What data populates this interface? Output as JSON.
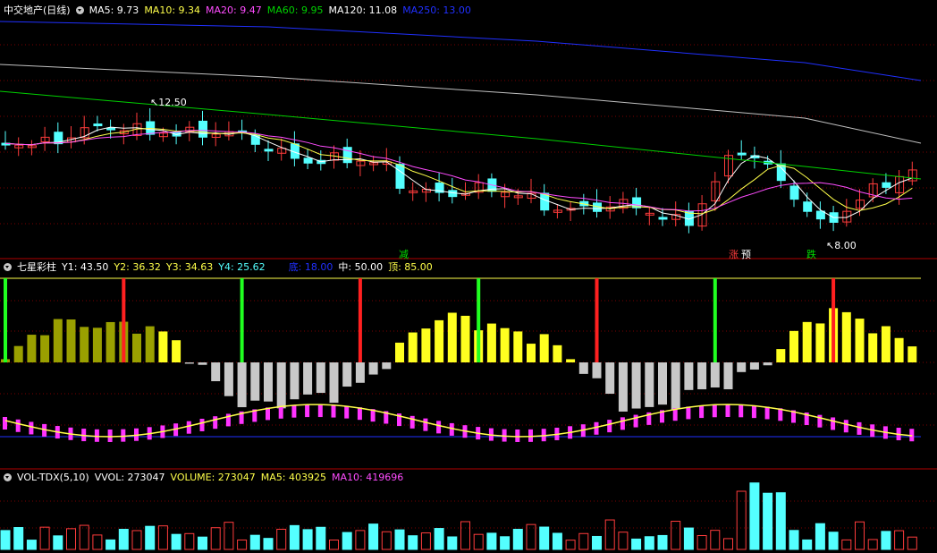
{
  "colors": {
    "up": "#ff3c3c",
    "down": "#54ffff",
    "ma5": "#ffffff",
    "ma10": "#ffff4a",
    "ma20": "#ff4cff",
    "ma60": "#00d000",
    "ma120": "#c0c0c0",
    "ma250": "#2030ff",
    "grid": "#7a0000"
  },
  "main": {
    "menu_icon": "chevron-down-icon",
    "title": "中交地产(日线)",
    "indicators": [
      {
        "text": "MA5: 9.73",
        "color": "#ffffff"
      },
      {
        "text": "MA10: 9.34",
        "color": "#ffff4a"
      },
      {
        "text": "MA20: 9.47",
        "color": "#ff4cff"
      },
      {
        "text": "MA60: 9.95",
        "color": "#00d000"
      },
      {
        "text": "MA120: 11.08",
        "color": "#ffffff"
      },
      {
        "text": "MA250: 13.00",
        "color": "#2030ff"
      }
    ],
    "high_label": "12.50",
    "low_label": "8.00",
    "signals": [
      {
        "text": "减",
        "color": "#00e000"
      },
      {
        "text": "涨",
        "color": "#ff3c3c"
      },
      {
        "text": "预",
        "color": "#ffffff"
      },
      {
        "text": "跌",
        "color": "#00e000"
      }
    ]
  },
  "qixing": {
    "menu_icon": "chevron-down-icon",
    "title": "七星彩柱",
    "values": [
      {
        "text": "Y1: 43.50",
        "color": "#ffffff"
      },
      {
        "text": "Y2: 36.32",
        "color": "#ffff4a"
      },
      {
        "text": "Y3: 34.63",
        "color": "#ffff4a"
      },
      {
        "text": "Y4: 25.62",
        "color": "#54ffff"
      }
    ],
    "levels": [
      {
        "text": "底: 18.00",
        "color": "#2030ff"
      },
      {
        "text": "中: 50.00",
        "color": "#ffffff"
      },
      {
        "text": "顶: 85.00",
        "color": "#ffff4a"
      }
    ]
  },
  "volume": {
    "menu_icon": "chevron-down-icon",
    "title": "VOL-TDX(5,10)",
    "values": [
      {
        "text": "VVOL: 273047",
        "color": "#ffffff"
      },
      {
        "text": "VOLUME: 273047",
        "color": "#ffff4a"
      },
      {
        "text": "MA5: 403925",
        "color": "#ffff4a"
      },
      {
        "text": "MA10: 419696",
        "color": "#ff4cff"
      }
    ]
  }
}
